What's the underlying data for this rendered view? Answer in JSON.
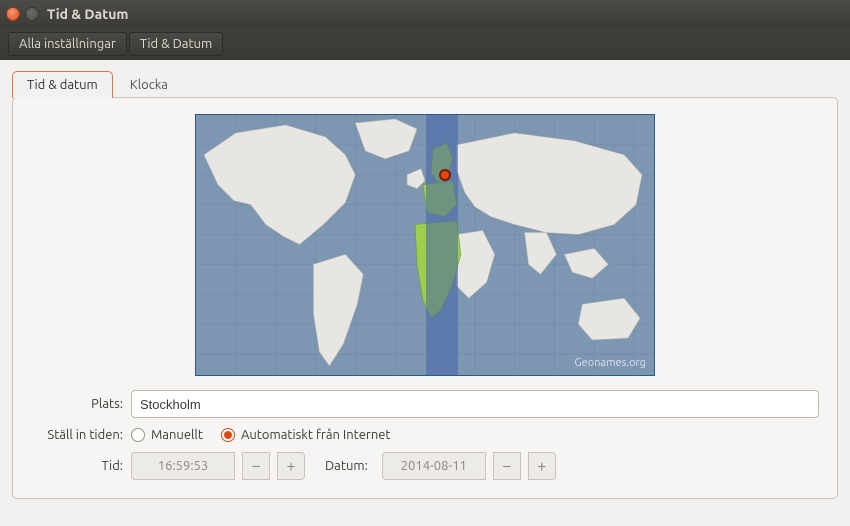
{
  "window": {
    "title": "Tid & Datum"
  },
  "toolbar": {
    "all_settings": "Alla inställningar",
    "time_date": "Tid & Datum"
  },
  "tabs": {
    "time_date": "Tid & datum",
    "clock": "Klocka"
  },
  "map": {
    "attribution": "Geonames.org",
    "selected_location": "Stockholm"
  },
  "labels": {
    "location": "Plats:",
    "set_time": "Ställ in tiden:",
    "time": "Tid:",
    "date": "Datum:"
  },
  "location": {
    "value": "Stockholm"
  },
  "set_time": {
    "manual": "Manuellt",
    "automatic": "Automatiskt från Internet",
    "selected": "automatic"
  },
  "time": {
    "value": "16:59:53"
  },
  "date": {
    "value": "2014-08-11"
  },
  "steppers": {
    "minus": "−",
    "plus": "+"
  }
}
